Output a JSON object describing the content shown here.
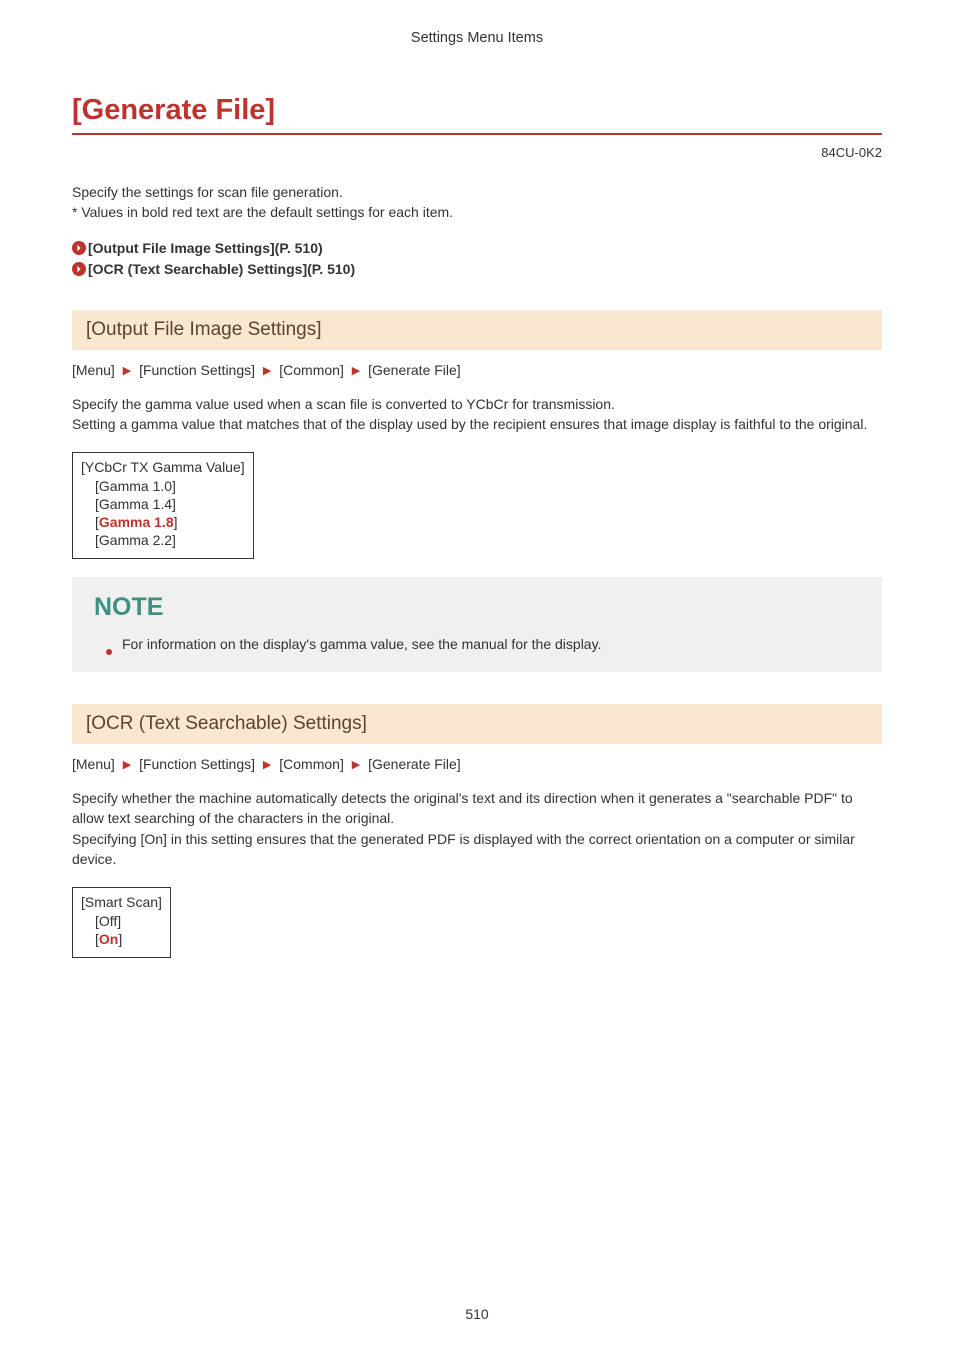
{
  "header": {
    "section": "Settings Menu Items"
  },
  "title": "[Generate File]",
  "doc_code": "84CU-0K2",
  "intro_lines": [
    "Specify the settings for scan file generation.",
    "* Values in bold red text are the default settings for each item."
  ],
  "toc": [
    {
      "label": "[Output File Image Settings](P. 510)"
    },
    {
      "label": "[OCR (Text Searchable) Settings](P. 510)"
    }
  ],
  "breadcrumb": [
    "[Menu]",
    "[Function Settings]",
    "[Common]",
    "[Generate File]"
  ],
  "section1": {
    "heading": "[Output File Image Settings]",
    "desc": "Specify the gamma value used when a scan file is converted to YCbCr for transmission.\nSetting a gamma value that matches that of the display used by the recipient ensures that image display is faithful to the original.",
    "option_label": "[YCbCr TX Gamma Value]",
    "options": [
      {
        "text": "[Gamma 1.0]"
      },
      {
        "text": "[Gamma 1.4]"
      },
      {
        "prefix": "[",
        "default": "Gamma 1.8",
        "suffix": "]"
      },
      {
        "text": "[Gamma 2.2]"
      }
    ],
    "note_title": "NOTE",
    "note_text": "For information on the display's gamma value, see the manual for the display."
  },
  "section2": {
    "heading": "[OCR (Text Searchable) Settings]",
    "desc": "Specify whether the machine automatically detects the original's text and its direction when it generates a \"searchable PDF\" to allow text searching of the characters in the original.\nSpecifying [On] in this setting ensures that the generated PDF is displayed with the correct orientation on a computer or similar device.",
    "option_label": "[Smart Scan]",
    "options": [
      {
        "text": "[Off]"
      },
      {
        "prefix": "[",
        "default": "On",
        "suffix": "]"
      }
    ]
  },
  "page_number": "510"
}
